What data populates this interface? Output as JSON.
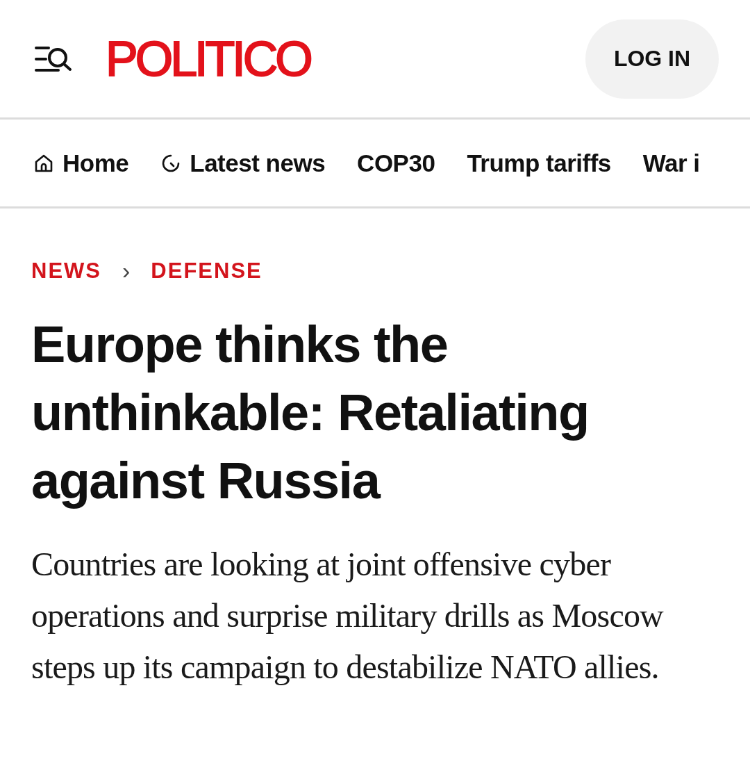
{
  "header": {
    "logo": "POLITICO",
    "login_button": "LOG IN"
  },
  "nav": [
    {
      "label": "Home",
      "kind": "home"
    },
    {
      "label": "Latest news",
      "kind": "clock"
    },
    {
      "label": "COP30",
      "kind": "plain"
    },
    {
      "label": "Trump tariffs",
      "kind": "plain"
    },
    {
      "label": "War i",
      "kind": "plain"
    }
  ],
  "breadcrumb": {
    "items": [
      "NEWS",
      "DEFENSE"
    ],
    "separator": "›"
  },
  "headline": "Europe thinks the unthinkable: Retaliating against Russia",
  "deck": "Countries are looking at joint offensive cyber operations and surprise military drills as Moscow steps up its campaign to destabilize NATO allies."
}
